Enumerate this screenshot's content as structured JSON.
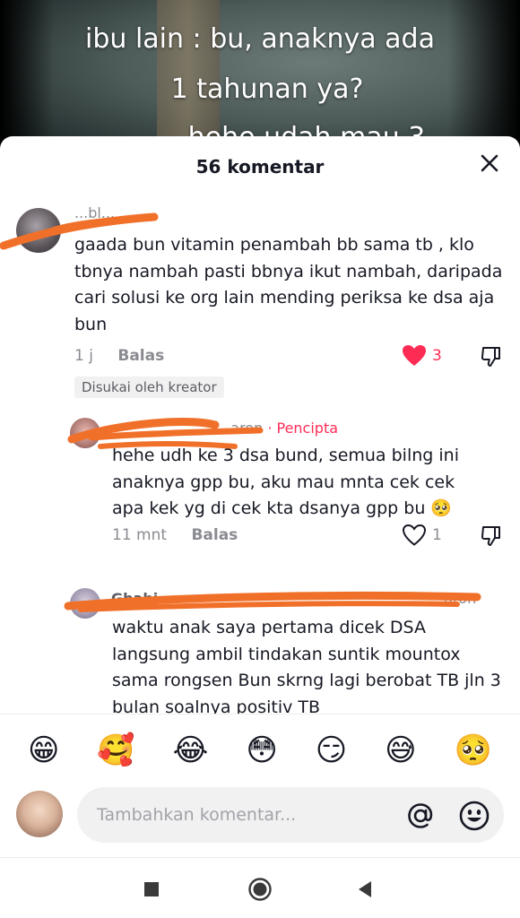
{
  "video": {
    "caption_lines": [
      "ibu lain : bu, anaknya ada",
      "1 tahunan ya?",
      "hehe udah mau 3"
    ]
  },
  "sheet": {
    "title": "56 komentar",
    "close_icon": "close-icon"
  },
  "comments": [
    {
      "username": "...bl...",
      "text": "gaada bun vitamin penambah bb sama tb , klo tbnya nambah pasti bbnya ikut nambah, daripada cari solusi ke org lain mending periksa ke dsa aja bun",
      "time": "1 j",
      "reply_label": "Balas",
      "likes": "3",
      "liked": true,
      "badge": "Disukai oleh kreator"
    },
    {
      "username": "...",
      "author_name_visible": "...aron",
      "creator_tag": "· Pencipta",
      "text": "hehe udh ke 3 dsa bund, semua bilng ini anaknya gpp bu, aku mau mnta cek cek apa kek yg di cek kta dsanya gpp bu 🥺",
      "time": "11 mnt",
      "reply_label": "Balas",
      "likes": "1",
      "liked": false
    },
    {
      "username": "Ghabi...",
      "reply_to": "...aron",
      "text": "waktu anak saya pertama dicek DSA langsung ambil tindakan suntik mountox sama rongsen Bun skrng lagi berobat TB jln 3 bulan soalnya positiv TB"
    }
  ],
  "emoji_bar": [
    "😁",
    "🥰",
    "😂",
    "😳",
    "😏",
    "😅",
    "🥺"
  ],
  "input": {
    "placeholder": "Tambahkan komentar...",
    "at_icon": "at-icon",
    "emoji_icon": "emoji-icon"
  },
  "nav": {
    "icons": [
      "recents-icon",
      "home-icon",
      "back-icon"
    ]
  },
  "colors": {
    "accent": "#fe2c55",
    "text": "#161823",
    "muted": "#8a8b91",
    "badge_bg": "#f1f1f2",
    "scribble": "#f0702a"
  }
}
